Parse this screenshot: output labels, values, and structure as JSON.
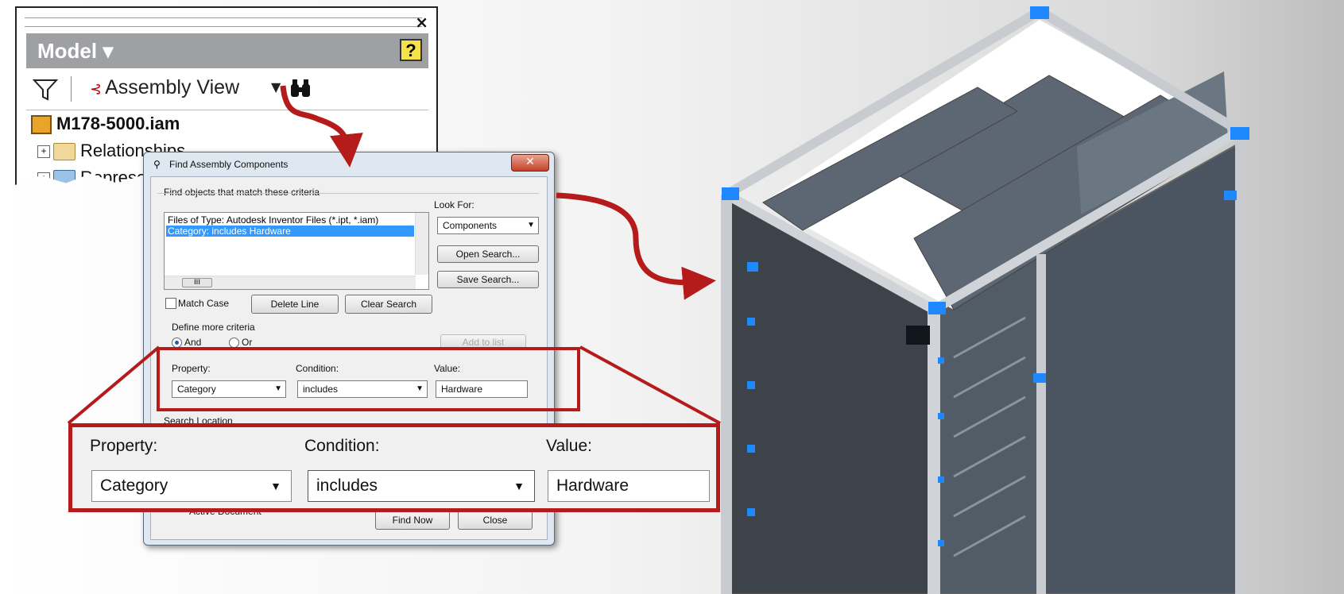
{
  "model_panel": {
    "close_glyph": "×",
    "header_title": "Model ▾",
    "help_glyph": "?",
    "view_label": "Assembly View",
    "view_dropdown_glyph": "▼",
    "find_glyph": "🔭",
    "tree": {
      "root": "M178-5000.iam",
      "items": [
        "Relationships",
        "Represe"
      ]
    },
    "expander_glyph": "+"
  },
  "dialog": {
    "title": "Find Assembly Components",
    "close_glyph": "✕",
    "criteria_group_label": "Find objects that match these criteria",
    "criteria_list": [
      "Files of Type:   Autodesk Inventor Files (*.ipt, *.iam)",
      "Category:  includes  Hardware"
    ],
    "scroll_thumb": "III",
    "look_for_label": "Look For:",
    "look_for_value": "Components",
    "open_search": "Open Search...",
    "save_search": "Save Search...",
    "match_case": "Match Case",
    "delete_line": "Delete Line",
    "clear_search": "Clear Search",
    "define_more": "Define more criteria",
    "and_label": "And",
    "or_label": "Or",
    "add_to_list": "Add to list",
    "property_label": "Property:",
    "condition_label": "Condition:",
    "value_label": "Value:",
    "property_value": "Category",
    "condition_value": "includes",
    "value_value": "Hardware",
    "search_location": "Search Location",
    "active_document": "Active Document",
    "find_now": "Find Now",
    "close": "Close"
  },
  "zoom": {
    "property_label": "Property:",
    "condition_label": "Condition:",
    "value_label": "Value:",
    "property_value": "Category",
    "condition_value": "includes",
    "value_value": "Hardware"
  },
  "colors": {
    "callout_red": "#b51b1b",
    "highlight_blue": "#1e88ff",
    "panel_gray": "#5d6773"
  }
}
